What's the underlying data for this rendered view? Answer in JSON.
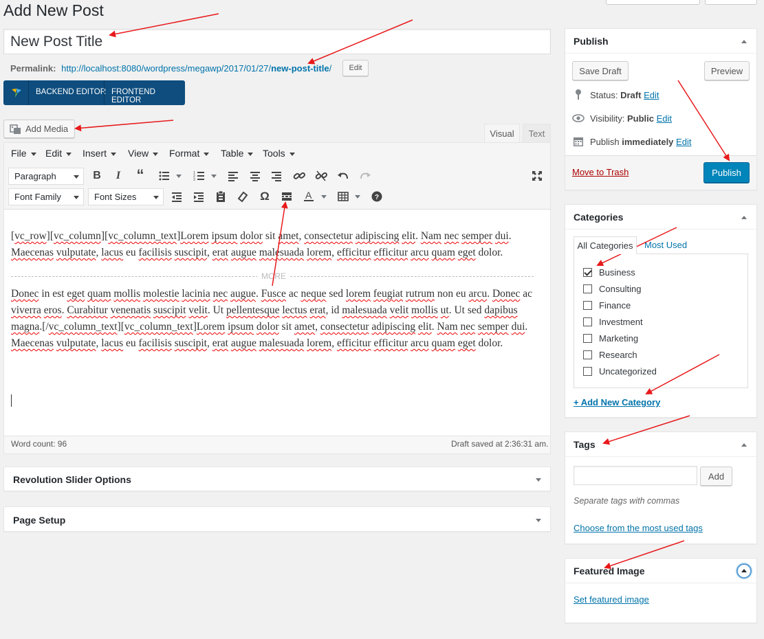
{
  "page": {
    "heading": "Add New Post"
  },
  "title_field": {
    "value": "New Post Title"
  },
  "permalink": {
    "label": "Permalink:",
    "url_base": "http://localhost:8080/wordpress/megawp/2017/01/27/",
    "slug": "new-post-title",
    "slash": "/",
    "edit_label": "Edit"
  },
  "vc_bar": {
    "backend": "BACKEND EDITOR",
    "frontend": "FRONTEND EDITOR"
  },
  "media": {
    "add_media": "Add Media"
  },
  "editor_tabs": {
    "visual": "Visual",
    "text": "Text"
  },
  "menubar": [
    "File",
    "Edit",
    "Insert",
    "View",
    "Format",
    "Table",
    "Tools"
  ],
  "toolbar": {
    "format_select": "Paragraph",
    "font_family": "Font Family",
    "font_sizes": "Font Sizes"
  },
  "content": {
    "p1_parts": [
      "[",
      "vc_row",
      "][",
      "vc_column",
      "][",
      "vc_column_text",
      "]",
      "Lorem",
      " ",
      "ipsum",
      " ",
      "dolor",
      " sit ",
      "amet",
      ", ",
      "consectetur",
      " ",
      "adipiscing",
      " ",
      "elit",
      ". ",
      "Nam",
      " ",
      "nec",
      " ",
      "semper",
      " ",
      "dui",
      ". ",
      "Maecenas",
      " ",
      "vulputate",
      ", ",
      "lacus",
      " eu ",
      "facilisis",
      " ",
      "suscipit",
      ", ",
      "erat",
      " ",
      "augue",
      " ",
      "malesuada",
      " ",
      "lorem",
      ", ",
      "efficitur",
      " ",
      "efficitur",
      " ",
      "arcu",
      " ",
      "quam",
      " ",
      "eget",
      " dolor."
    ],
    "more_label": "MORE",
    "p2_parts": [
      "Donec",
      " in est ",
      "eget",
      " ",
      "quam",
      " ",
      "mollis",
      " ",
      "molestie",
      " ",
      "lacinia",
      " ",
      "nec",
      " ",
      "augue",
      ". ",
      "Fusce",
      " ac ",
      "neque",
      " sed ",
      "lorem",
      " ",
      "feugiat",
      " ",
      "rutrum",
      " non eu ",
      "arcu",
      ". ",
      "Donec",
      " ac ",
      "viverra",
      " ",
      "eros",
      ". ",
      "Curabitur",
      " ",
      "venenatis",
      " ",
      "suscipit",
      " ",
      "velit",
      ". Ut ",
      "pellentesque",
      " ",
      "lectus",
      " ",
      "erat",
      ", id ",
      "malesuada",
      " ",
      "velit",
      " ",
      "mollis",
      " ",
      "ut",
      ". Ut sed ",
      "dapibus",
      " ",
      "magna",
      ".[/",
      "vc_column_text",
      "][",
      "vc_column_text",
      "]",
      "Lorem",
      " ",
      "ipsum",
      " ",
      "dolor",
      " sit ",
      "amet",
      ", ",
      "consectetur",
      " ",
      "adipiscing",
      " ",
      "elit",
      ". ",
      "Nam",
      " ",
      "nec",
      " ",
      "semper",
      " ",
      "dui",
      ". ",
      "Maecenas",
      " ",
      "vulputate",
      ", ",
      "lacus",
      " eu ",
      "facilisis",
      " ",
      "suscipit",
      ", ",
      "erat",
      " ",
      "augue",
      " ",
      "malesuada",
      " ",
      "lorem",
      ", ",
      "efficitur",
      " ",
      "efficitur",
      " ",
      "arcu",
      " ",
      "quam",
      " ",
      "eget",
      " dolor."
    ]
  },
  "status_bar": {
    "word_count": "Word count: 96",
    "draft_saved": "Draft saved at 2:36:31 am."
  },
  "metaboxes": {
    "revslider": "Revolution Slider Options",
    "page_setup": "Page Setup"
  },
  "publish": {
    "title": "Publish",
    "save_draft": "Save Draft",
    "preview": "Preview",
    "status_label": "Status:",
    "status_value": "Draft",
    "visibility_label": "Visibility:",
    "visibility_value": "Public",
    "publish_label": "Publish",
    "publish_value": "immediately",
    "edit": "Edit",
    "trash": "Move to Trash",
    "publish_button": "Publish"
  },
  "categories": {
    "title": "Categories",
    "tab_all": "All Categories",
    "tab_most": "Most Used",
    "items": [
      {
        "label": "Business",
        "checked": true
      },
      {
        "label": "Consulting",
        "checked": false
      },
      {
        "label": "Finance",
        "checked": false
      },
      {
        "label": "Investment",
        "checked": false
      },
      {
        "label": "Marketing",
        "checked": false
      },
      {
        "label": "Research",
        "checked": false
      },
      {
        "label": "Uncategorized",
        "checked": false
      }
    ],
    "add_new": "+ Add New Category"
  },
  "tags": {
    "title": "Tags",
    "add": "Add",
    "hint": "Separate tags with commas",
    "choose": "Choose from the most used tags"
  },
  "featured": {
    "title": "Featured Image",
    "set": "Set featured image"
  },
  "colors": {
    "accent": "#0073aa",
    "publish_blue": "#0085ba",
    "trash_red": "#a00",
    "vc_blue": "#0e4d7e",
    "arrow_red": "#e8191b"
  }
}
